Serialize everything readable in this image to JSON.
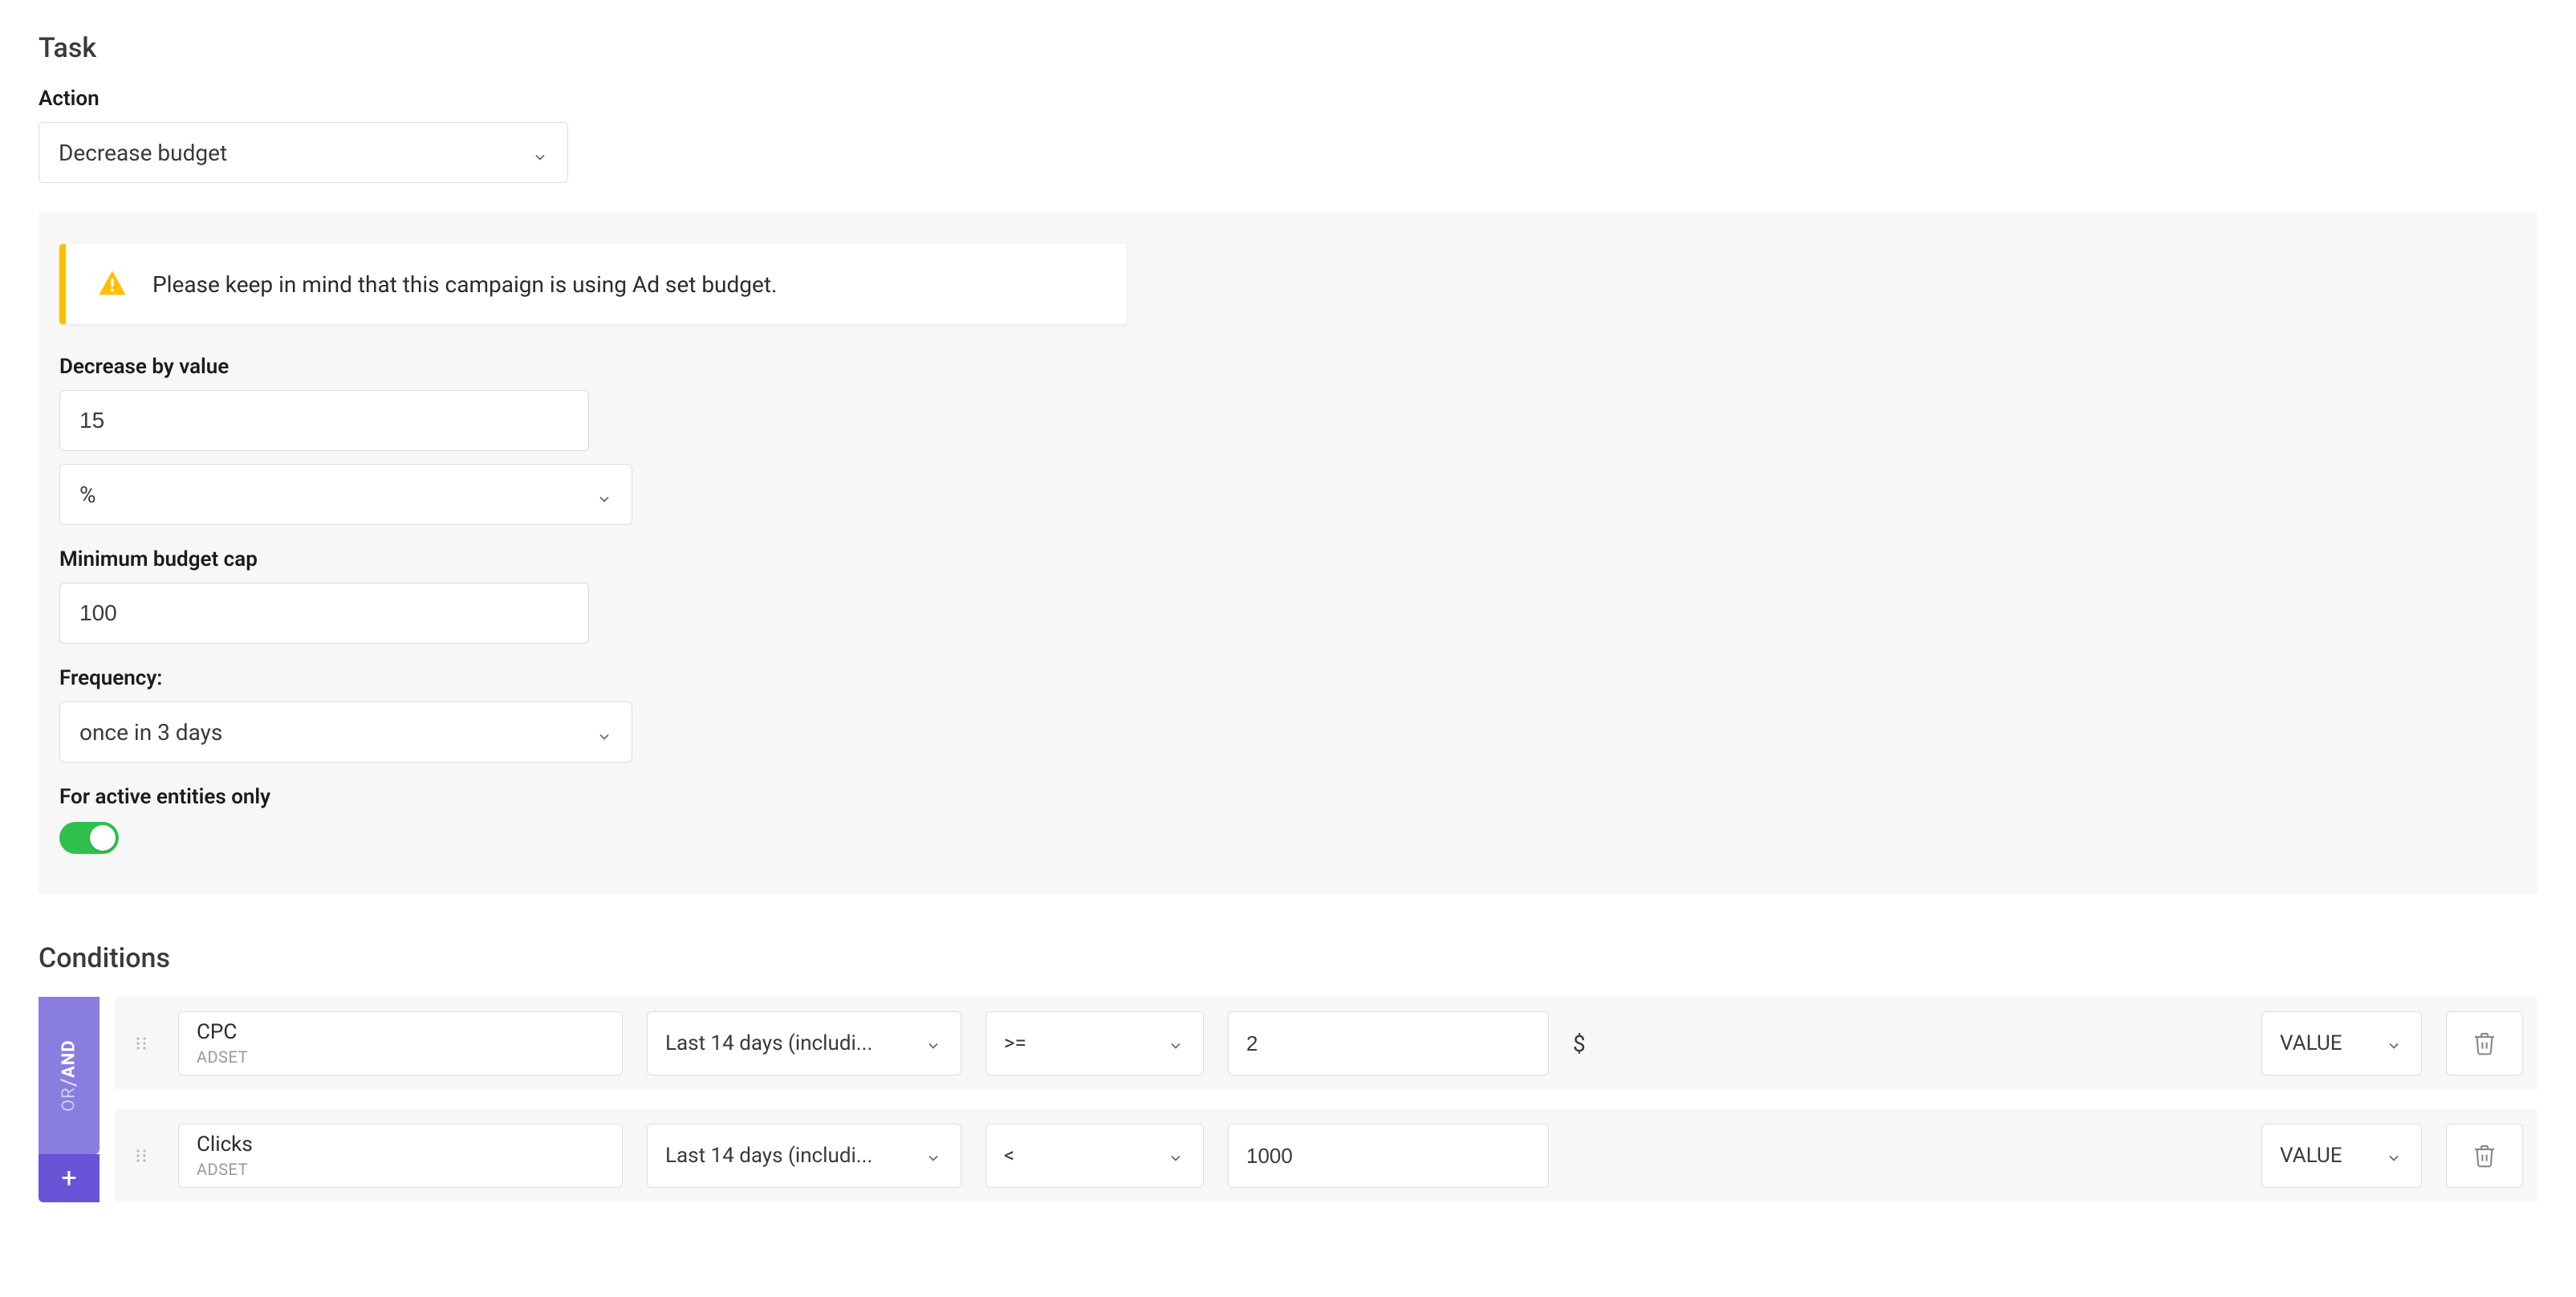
{
  "task": {
    "title": "Task",
    "action_label": "Action",
    "action_value": "Decrease budget",
    "alert_text": "Please keep in mind that this campaign is using Ad set budget.",
    "decrease_by_label": "Decrease by value",
    "decrease_by_value": "15",
    "decrease_by_unit": "%",
    "min_cap_label": "Minimum budget cap",
    "min_cap_value": "100",
    "frequency_label": "Frequency:",
    "frequency_value": "once in 3 days",
    "active_only_label": "For active entities only",
    "active_only_on": true
  },
  "conditions": {
    "title": "Conditions",
    "logic_and": "AND",
    "logic_or": "OR",
    "add_symbol": "+",
    "rows": [
      {
        "metric": "CPC",
        "level": "ADSET",
        "period": "Last 14 days (includi...",
        "operator": ">=",
        "value": "2",
        "unit": "$",
        "type": "VALUE"
      },
      {
        "metric": "Clicks",
        "level": "ADSET",
        "period": "Last 14 days (includi...",
        "operator": "<",
        "value": "1000",
        "unit": "",
        "type": "VALUE"
      }
    ]
  }
}
